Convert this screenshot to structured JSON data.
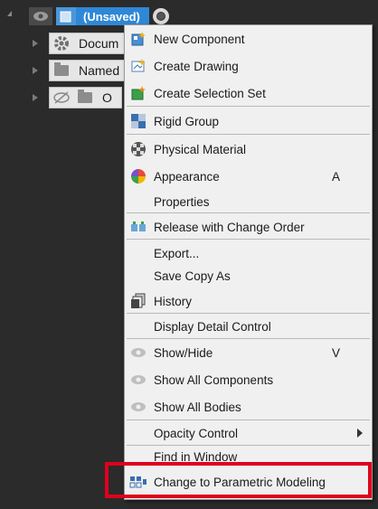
{
  "tree": {
    "root": {
      "title": "(Unsaved)"
    },
    "nodes": [
      {
        "label": "Docum",
        "icon": "gear-icon"
      },
      {
        "label": "Named",
        "icon": "folder-icon"
      },
      {
        "label": "O",
        "icon": "folder-icon",
        "hidden": true
      }
    ]
  },
  "menu": {
    "items": {
      "new_component": {
        "label": "New Component",
        "icon": "new-component-icon"
      },
      "create_drawing": {
        "label": "Create Drawing",
        "icon": "drawing-icon"
      },
      "create_selection_set": {
        "label": "Create Selection Set",
        "icon": "selection-set-icon"
      },
      "rigid_group": {
        "label": "Rigid Group",
        "icon": "rigid-group-icon"
      },
      "physical_material": {
        "label": "Physical Material",
        "icon": "material-icon"
      },
      "appearance": {
        "label": "Appearance",
        "shortcut": "A",
        "icon": "appearance-icon"
      },
      "properties": {
        "label": "Properties"
      },
      "release": {
        "label": "Release with Change Order",
        "icon": "release-icon"
      },
      "export": {
        "label": "Export..."
      },
      "save_copy": {
        "label": "Save Copy As"
      },
      "history": {
        "label": "History",
        "icon": "history-icon"
      },
      "display_detail": {
        "label": "Display Detail Control"
      },
      "show_hide": {
        "label": "Show/Hide",
        "shortcut": "V",
        "icon": "eye-icon"
      },
      "show_all_components": {
        "label": "Show All Components",
        "icon": "eye-icon"
      },
      "show_all_bodies": {
        "label": "Show All Bodies",
        "icon": "eye-icon"
      },
      "opacity_control": {
        "label": "Opacity Control",
        "icon": "chevron-right-icon"
      },
      "find_in_window": {
        "label": "Find in Window"
      },
      "change_parametric": {
        "label": "Change to Parametric Modeling",
        "icon": "parametric-icon"
      }
    }
  },
  "colors": {
    "highlight": "#e0001b",
    "selected": "#2f88d6"
  }
}
